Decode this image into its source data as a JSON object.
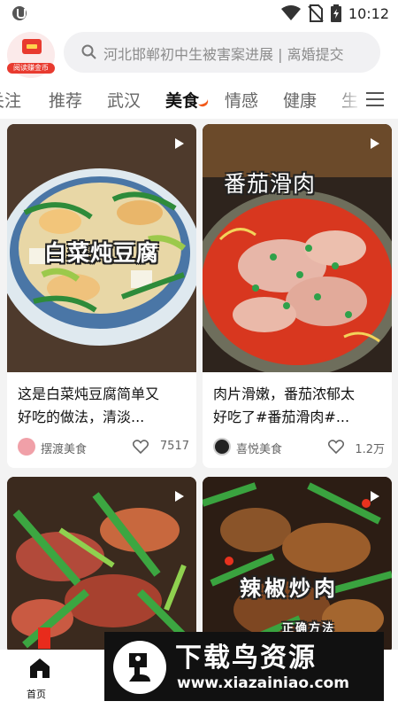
{
  "status_bar": {
    "time": "10:12"
  },
  "header": {
    "logo_label": "阅读赚金币",
    "search_placeholder": "河北邯郸初中生被害案进展 | 离婚提交"
  },
  "tabs": [
    "关注",
    "推荐",
    "武汉",
    "美食",
    "情感",
    "健康",
    "生"
  ],
  "active_tab": "美食",
  "feed": [
    {
      "overlay": "白菜炖豆腐",
      "title_line1": "这是白菜炖豆腐简单又",
      "title_line2": "好吃的做法，清淡...",
      "author": "摆渡美食",
      "likes": "7517"
    },
    {
      "overlay": "番茄滑肉",
      "title_line1": "肉片滑嫩，番茄浓郁太",
      "title_line2": "好吃了#番茄滑肉#...",
      "author": "喜悦美食",
      "likes": "1.2万"
    },
    {
      "overlay": ""
    },
    {
      "overlay": "辣椒炒肉",
      "subtitle": "正确方法"
    }
  ],
  "bottom_nav": {
    "home_label": "首页"
  },
  "watermark": {
    "title": "下载鸟资源",
    "url": "www.xiazainiao.com"
  },
  "colors": {
    "accent": "#f25a1a",
    "brand_red": "#e83a2f"
  },
  "icons": [
    "shield-icon",
    "wifi-icon",
    "no-sim-icon",
    "battery-icon",
    "search-icon",
    "menu-icon",
    "play-icon",
    "heart-icon",
    "home-icon"
  ]
}
